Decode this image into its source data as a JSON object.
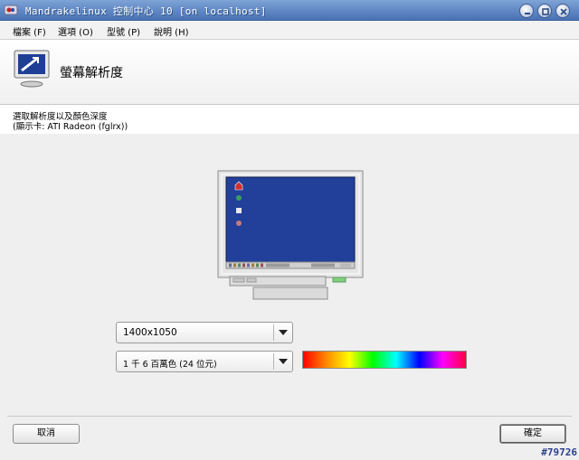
{
  "window": {
    "title": "Mandrakelinux 控制中心 10 [on localhost]",
    "app_icon": "mandrake-star-icon",
    "controls": [
      "minimize-icon",
      "maximize-icon",
      "close-icon"
    ]
  },
  "menubar": {
    "items": [
      {
        "label": "檔案 (F)"
      },
      {
        "label": "選項 (O)"
      },
      {
        "label": "型號 (P)"
      },
      {
        "label": "說明 (H)"
      }
    ]
  },
  "header": {
    "title": "螢幕解析度",
    "icon": "monitor-resolution-icon"
  },
  "description": {
    "line1": "選取解析度以及顏色深度",
    "line2": "(顯示卡: ATI Radeon (fglrx))"
  },
  "resolution": {
    "selected": "1400x1050"
  },
  "color_depth": {
    "selected": "1 千 6 百萬色 (24 位元)"
  },
  "buttons": {
    "cancel": "取消",
    "ok": "確定"
  },
  "watermark": "#79726",
  "colors": {
    "titlebar": "#5f87c4",
    "monitor_screen": "#22409a",
    "content_bg": "#efefef"
  }
}
